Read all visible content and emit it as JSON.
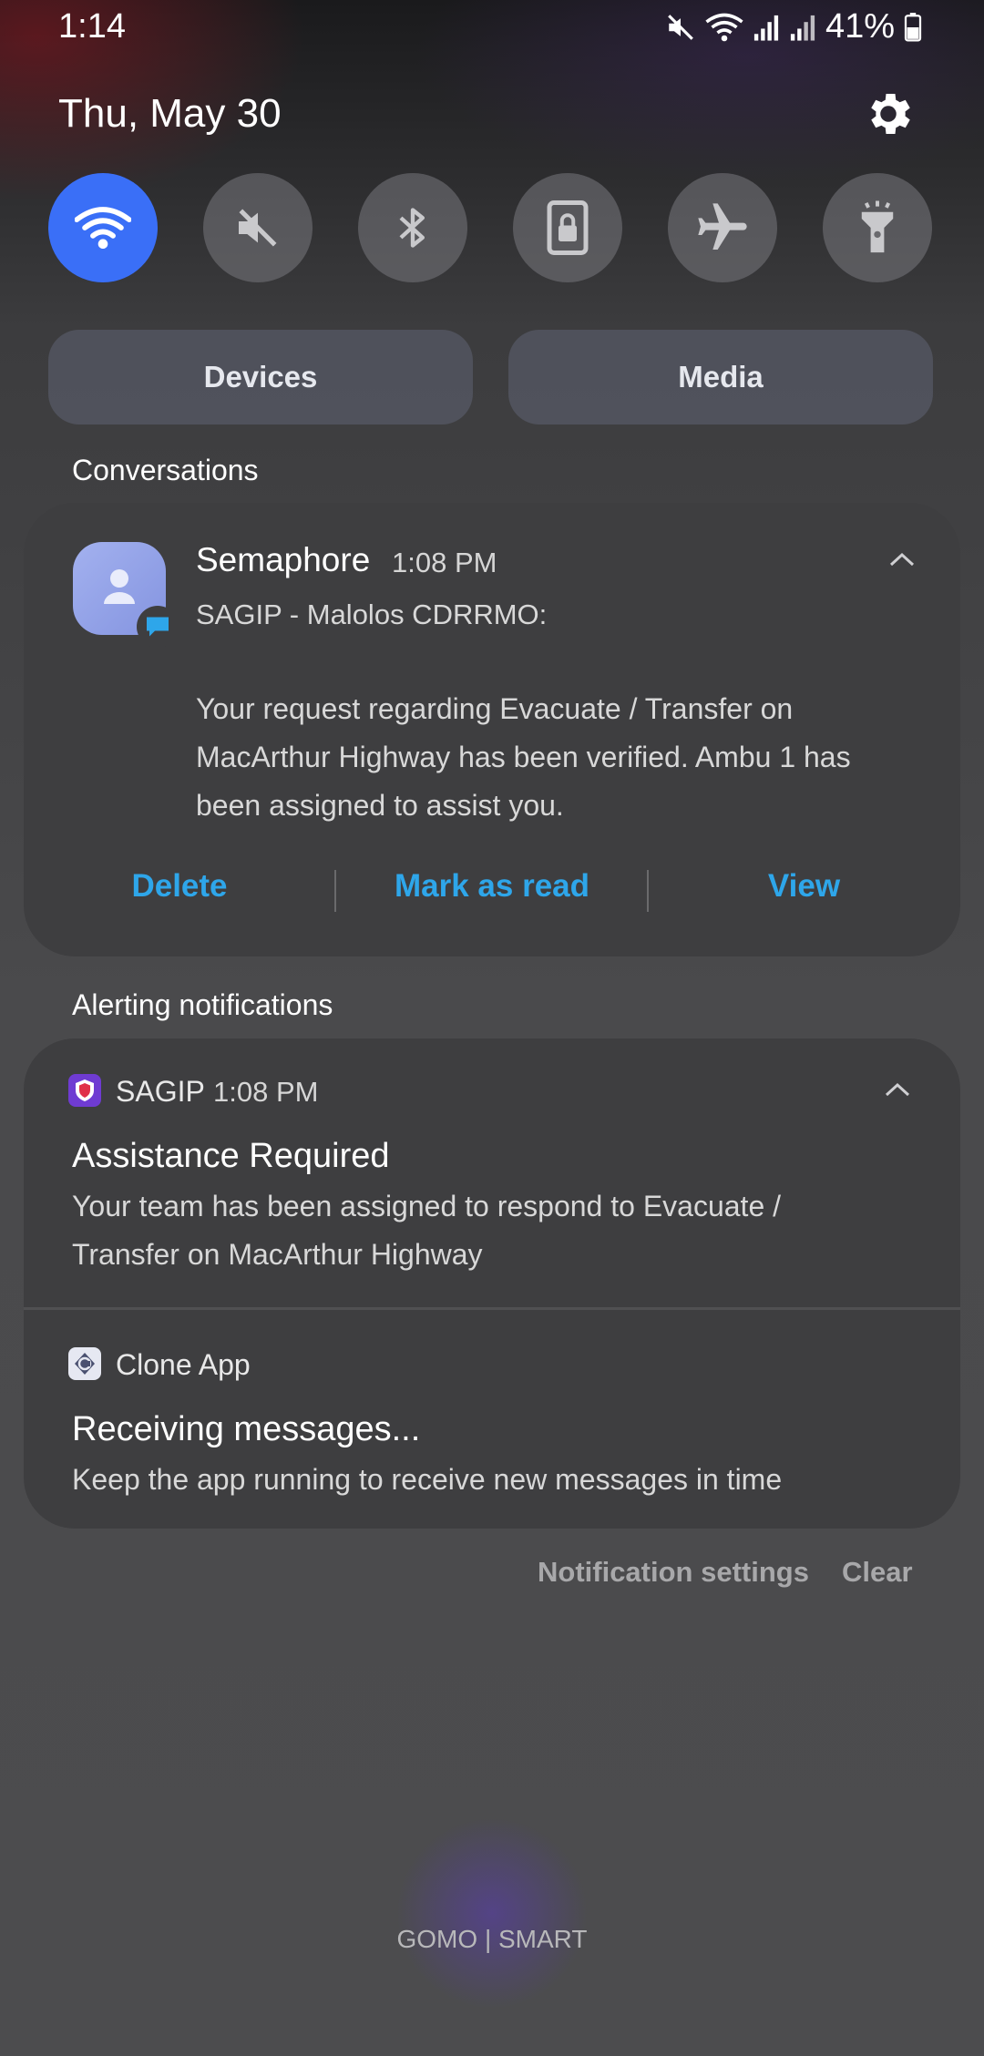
{
  "status_bar": {
    "time": "1:14",
    "battery": "41%",
    "icons": [
      "mute-icon",
      "wifi-icon",
      "signal-icon",
      "signal-icon",
      "battery-icon"
    ]
  },
  "header": {
    "date": "Thu, May 30",
    "settings_icon": "gear-icon"
  },
  "quick_settings": {
    "toggles": [
      {
        "name": "wifi",
        "icon": "wifi-icon",
        "on": true
      },
      {
        "name": "sound",
        "icon": "mute-icon",
        "on": false
      },
      {
        "name": "bluetooth",
        "icon": "bluetooth-icon",
        "on": false
      },
      {
        "name": "portrait-lock",
        "icon": "lock-icon",
        "on": false
      },
      {
        "name": "airplane-mode",
        "icon": "airplane-icon",
        "on": false
      },
      {
        "name": "flashlight",
        "icon": "flashlight-icon",
        "on": false
      }
    ],
    "devices_label": "Devices",
    "media_label": "Media"
  },
  "conversations": {
    "section_label": "Conversations",
    "card": {
      "app_name": "Semaphore",
      "time": "1:08 PM",
      "sender": "SAGIP - Malolos CDRRMO:",
      "body": "Your request regarding Evacuate / Transfer on MacArthur Highway has been verified. Ambu 1 has been assigned to assist you.",
      "actions": {
        "delete": "Delete",
        "mark_read": "Mark as read",
        "view": "View"
      }
    }
  },
  "alerting": {
    "section_label": "Alerting notifications",
    "notifications": [
      {
        "app_name": "SAGIP",
        "time": "1:08 PM",
        "title": "Assistance Required",
        "body": "Your team has been assigned to respond to Evacuate / Transfer on MacArthur Highway"
      },
      {
        "app_name": "Clone App",
        "title": "Receiving messages...",
        "body": "Keep the app running to receive new messages in time"
      }
    ]
  },
  "footer": {
    "notification_settings": "Notification settings",
    "clear": "Clear"
  },
  "carrier": "GOMO | SMART",
  "colors": {
    "accent_toggle": "#3a6ff7",
    "action_text": "#2ea6ea",
    "card_bg": "#3e3e40"
  }
}
